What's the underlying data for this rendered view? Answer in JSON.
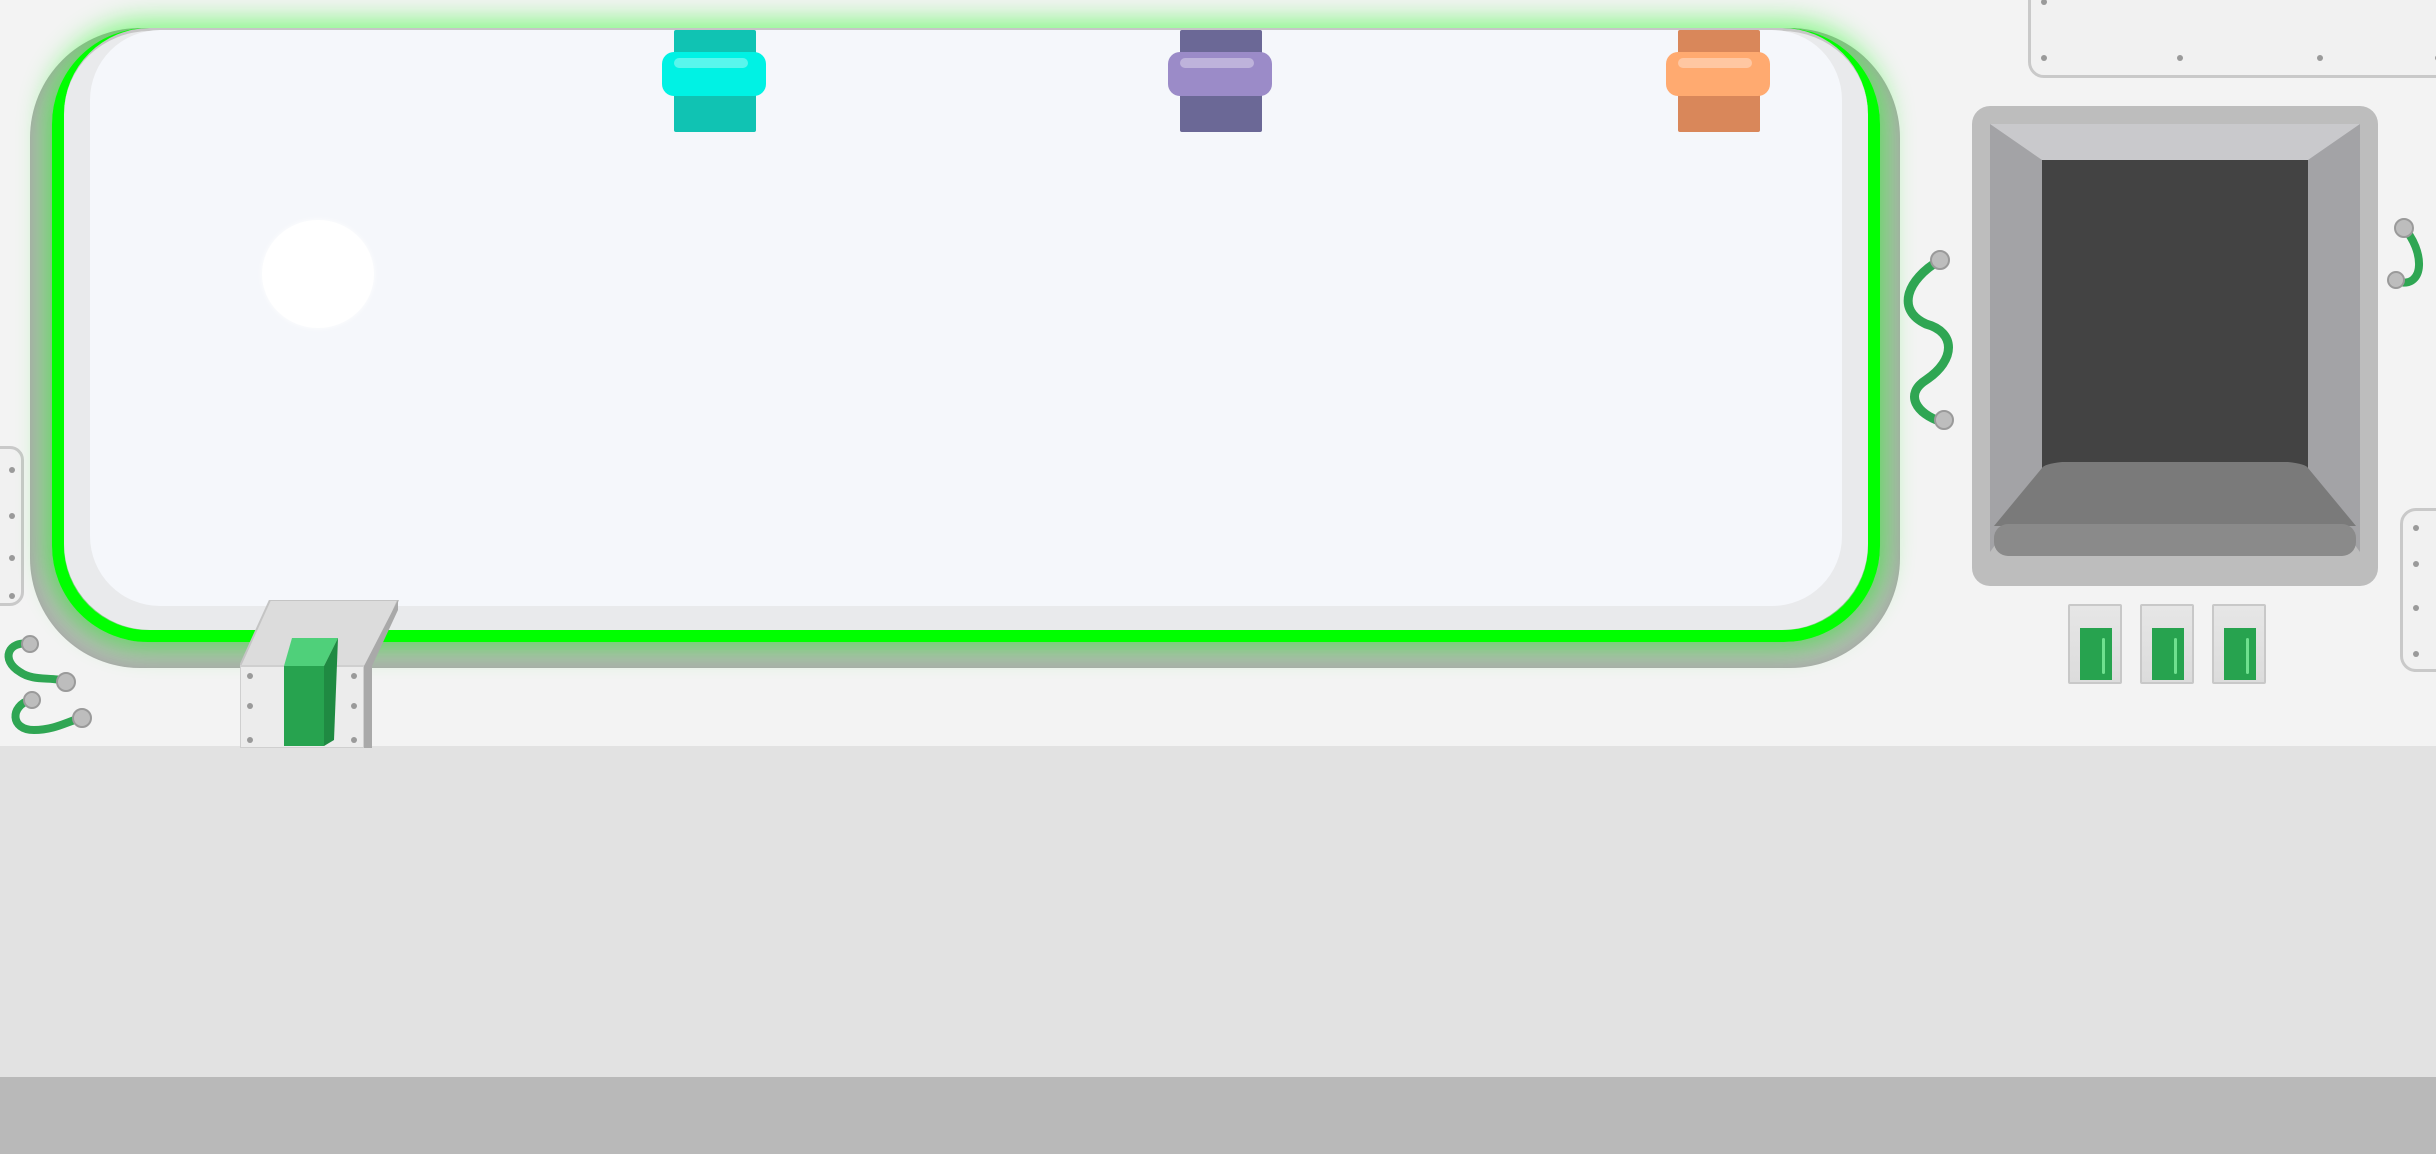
{
  "scene": {
    "colors": {
      "backdrop": "#f3f3f3",
      "floor": "#e2e2e2",
      "floor_edge": "#b9b9b9",
      "board_glow": "#00ff00",
      "board_surface": "#f5f7fb",
      "cable_green": "#2fa653",
      "card_green": "#27a34f"
    },
    "board": {
      "state": "highlighted",
      "highlight_color": "#00ff00"
    },
    "clips": [
      {
        "name": "teal",
        "strap": "#10c3b3",
        "band": "#00f2e4"
      },
      {
        "name": "purple",
        "strap": "#6b6896",
        "band": "#9b8bc8"
      },
      {
        "name": "orange",
        "strap": "#d9875a",
        "band": "#ffaa70"
      }
    ],
    "tray": {
      "frame": "#bdbdbd",
      "inner": "#434343",
      "drawer": "#7a7a7a"
    },
    "icons": [
      "cable-icon",
      "screw-icon",
      "card-slot-icon",
      "stand-icon"
    ]
  }
}
